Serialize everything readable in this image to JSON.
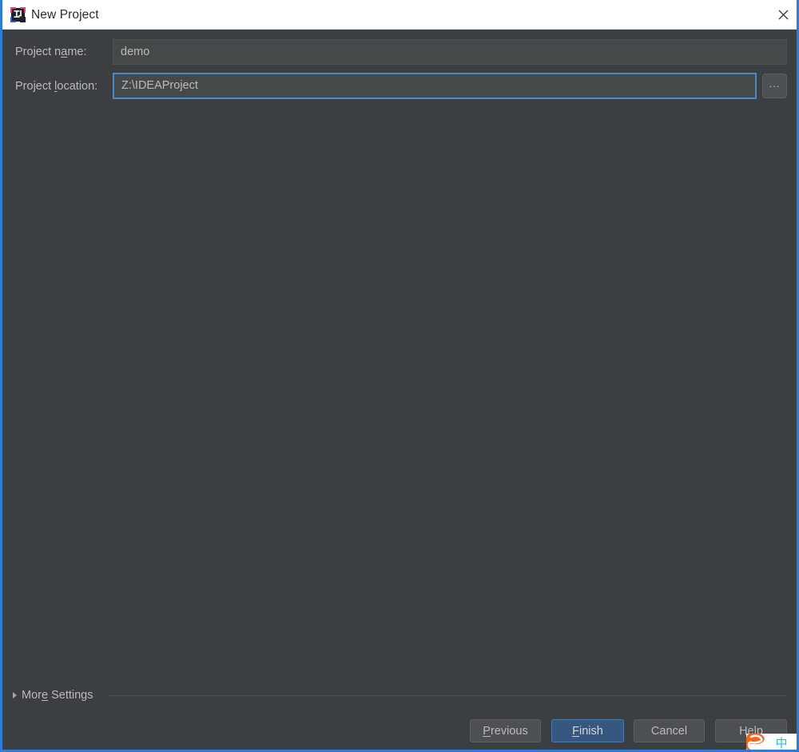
{
  "window": {
    "title": "New Project",
    "app_icon": "intellij-idea-icon",
    "close_icon": "close-icon",
    "accent_border_color": "#2d7cd6",
    "background_color": "#3c3f41",
    "titlebar_background": "#ffffff"
  },
  "form": {
    "project_name": {
      "label_prefix": "Project n",
      "label_mnemonic": "a",
      "label_suffix": "me:",
      "value": "demo",
      "placeholder": ""
    },
    "project_location": {
      "label_prefix": "Project ",
      "label_mnemonic": "l",
      "label_suffix": "ocation:",
      "value": "Z:\\IDEAProject",
      "placeholder": "",
      "focused": true,
      "focus_color": "#4a88c7"
    },
    "browse_button": {
      "label": "...",
      "icon": "ellipsis-icon"
    }
  },
  "more_settings": {
    "label_prefix": "Mor",
    "label_mnemonic": "e",
    "label_suffix": " Settings",
    "expanded": false,
    "arrow_icon": "triangle-right-icon"
  },
  "buttons": {
    "previous": {
      "prefix": "",
      "mnemonic": "P",
      "suffix": "revious"
    },
    "finish": {
      "prefix": "",
      "mnemonic": "F",
      "suffix": "inish",
      "default": true,
      "color": "#365880"
    },
    "cancel": {
      "prefix": "Cancel",
      "mnemonic": "",
      "suffix": ""
    },
    "help": {
      "prefix": "Help",
      "mnemonic": "",
      "suffix": ""
    }
  },
  "ime": {
    "logo_text": "S",
    "language_mode": "中",
    "logo_color": "#f4641e",
    "language_color": "#23c3d4"
  }
}
